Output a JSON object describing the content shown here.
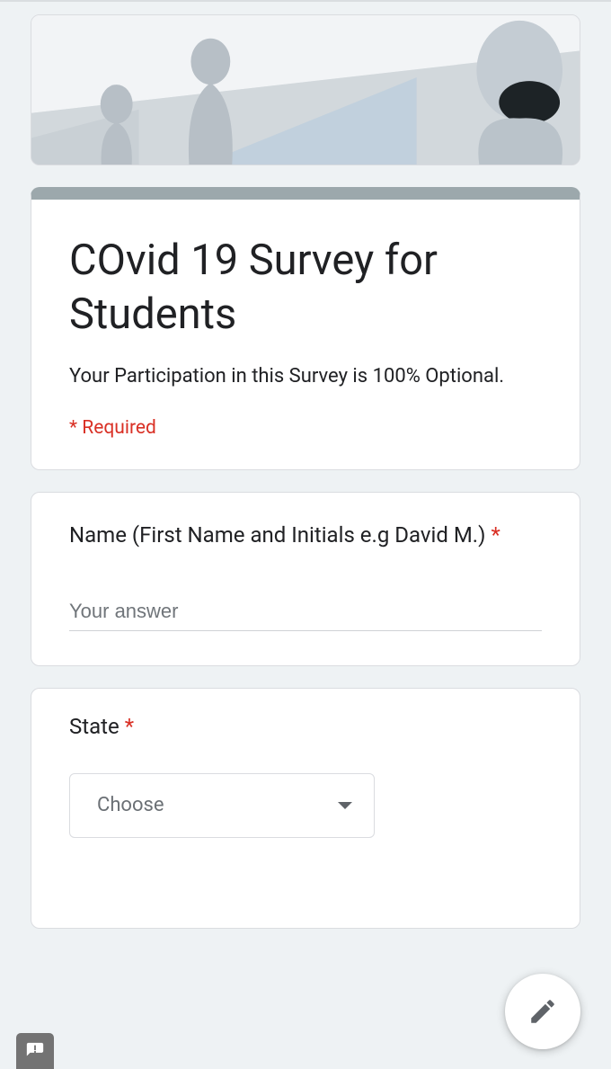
{
  "form": {
    "title": "COvid 19 Survey for Students",
    "description": "Your Participation in this Survey is 100% Optional.",
    "required_legend": "* Required"
  },
  "q_name": {
    "label": "Name (First Name and Initials e.g David M.)",
    "asterisk": "*",
    "placeholder": "Your answer"
  },
  "q_state": {
    "label": "State",
    "asterisk": "*",
    "selected": "Choose"
  }
}
